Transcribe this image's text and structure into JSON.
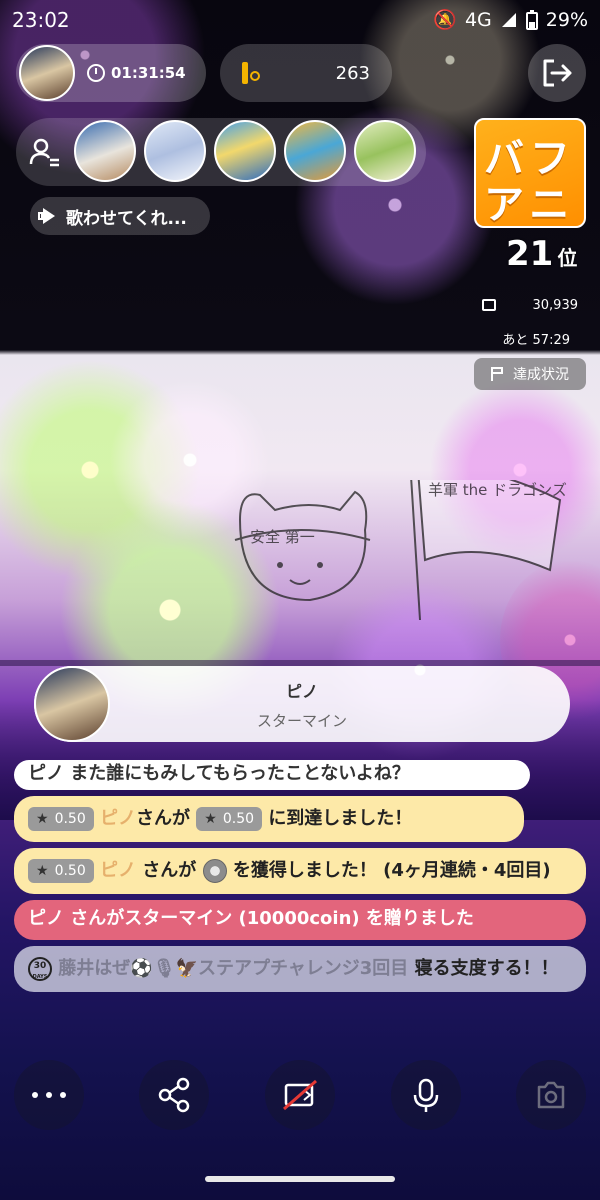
{
  "status_bar": {
    "time": "23:02",
    "network": "4G",
    "battery": "29%"
  },
  "header": {
    "timer": "01:31:54",
    "viewer_count": "263"
  },
  "song_request": "歌わせてくれ...",
  "ranking": {
    "logo_line1": "バフ",
    "logo_line2": "アニ",
    "rank_number": "21",
    "rank_suffix": "位",
    "gift_total": "30,939",
    "remaining": "あと 57:29",
    "progress_label": "達成状況"
  },
  "stage_sketch": {
    "helmet_text": "安全 第一",
    "flag_text": "羊軍 the ドラゴンズ"
  },
  "gift_banner": {
    "sender": "ピノ",
    "gift_name": "スターマイン"
  },
  "chat": {
    "partial_message": "ピノ また誰にもみしてもらったことないよね？",
    "level_badge": "0.50",
    "msg1_name": "ピノ",
    "msg1_mid": "さんが",
    "msg1_end": "に到達しました！",
    "msg2_name": "ピノ",
    "msg2_mid": " さんが",
    "msg2_end": "を獲得しました！ (4ヶ月連続・4回目)",
    "msg3_name": "ピノ",
    "msg3_text": " さんがスターマイン (10000coin) を贈りました",
    "msg4_days_num": "30",
    "msg4_days_label": "DAYS",
    "msg4_name": "藤井はぜ⚽🎙🦅ステアプチャレンジ3回目",
    "msg4_text": " 寝る支度する！！"
  },
  "icons": [
    "person-list-icon",
    "exit-icon",
    "megaphone-icon",
    "gift-icon",
    "flag-icon",
    "more-icon",
    "share-icon",
    "camera-off-icon",
    "mic-icon",
    "flip-camera-icon",
    "clock-icon"
  ]
}
